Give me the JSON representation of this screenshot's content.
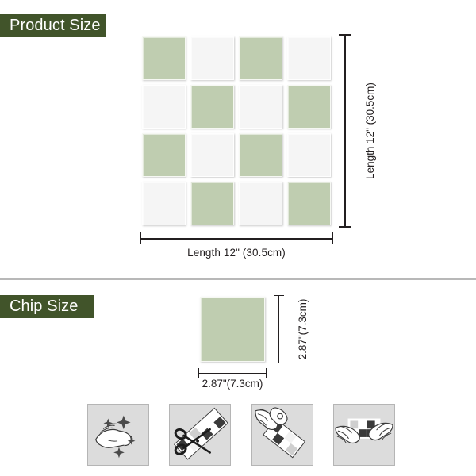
{
  "sections": {
    "product": {
      "badge_label": "Product Size",
      "width_label": "Length 12\" (30.5cm)",
      "height_label": "Length 12\" (30.5cm)",
      "grid": {
        "rows": 4,
        "cols": 4,
        "pattern": [
          [
            "green",
            "white",
            "green",
            "white"
          ],
          [
            "white",
            "green",
            "white",
            "green"
          ],
          [
            "green",
            "white",
            "green",
            "white"
          ],
          [
            "white",
            "green",
            "white",
            "green"
          ]
        ]
      }
    },
    "chip": {
      "badge_label": "Chip Size",
      "width_label": "2.87\"(7.3cm)",
      "height_label": "2.87\"(7.3cm)"
    }
  },
  "colors": {
    "badge_green": "#41542a",
    "tile_green": "#bfcdb0",
    "tile_white": "#f5f5f5",
    "divider": "#b8b8b8",
    "step_background": "#dcdcdc",
    "line": "#231f20"
  },
  "instruction_steps": [
    {
      "icon": "hand-wipe-clean-icon",
      "order": 1
    },
    {
      "icon": "scissors-cut-tile-icon",
      "order": 2
    },
    {
      "icon": "hands-peel-backing-icon",
      "order": 3
    },
    {
      "icon": "hands-press-tile-icon",
      "order": 4
    }
  ]
}
